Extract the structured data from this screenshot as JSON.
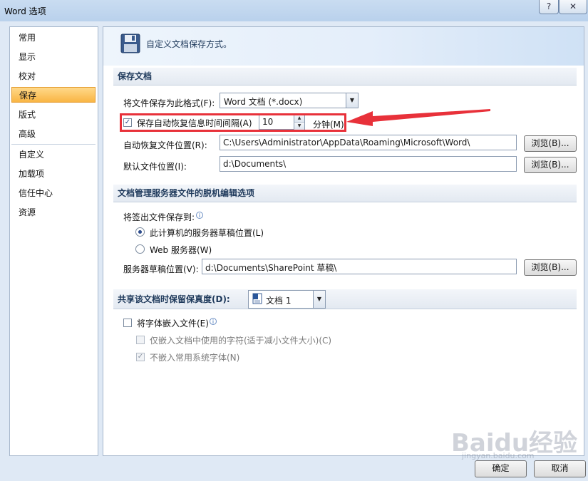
{
  "window": {
    "title": "Word 选项",
    "help_label": "?",
    "close_label": "✕"
  },
  "sidebar": {
    "items": [
      {
        "label": "常用"
      },
      {
        "label": "显示"
      },
      {
        "label": "校对"
      },
      {
        "label": "保存",
        "selected": true
      },
      {
        "label": "版式"
      },
      {
        "label": "高级"
      },
      {
        "label": "自定义"
      },
      {
        "label": "加载项"
      },
      {
        "label": "信任中心"
      },
      {
        "label": "资源"
      }
    ]
  },
  "banner": {
    "text": "自定义文档保存方式。"
  },
  "save_section": {
    "heading": "保存文档",
    "format_label": "将文件保存为此格式(F):",
    "format_value": "Word 文档 (*.docx)",
    "autorecover_label": "保存自动恢复信息时间间隔(A)",
    "autorecover_checked": true,
    "autorecover_minutes": "10",
    "minutes_label": "分钟(M)",
    "autorecover_path_label": "自动恢复文件位置(R):",
    "autorecover_path": "C:\\Users\\Administrator\\AppData\\Roaming\\Microsoft\\Word\\",
    "default_path_label": "默认文件位置(I):",
    "default_path": "d:\\Documents\\",
    "browse_label": "浏览(B)..."
  },
  "offline_section": {
    "heading": "文档管理服务器文件的脱机编辑选项",
    "checkout_label": "将签出文件保存到:",
    "option_local": "此计算机的服务器草稿位置(L)",
    "option_web": "Web 服务器(W)",
    "selected_option": "local",
    "drafts_label": "服务器草稿位置(V):",
    "drafts_path": "d:\\Documents\\SharePoint 草稿\\",
    "browse_label": "浏览(B)..."
  },
  "fidelity_section": {
    "heading": "共享该文档时保留保真度(D):",
    "document_value": "文档 1",
    "embed_fonts_label": "将字体嵌入文件(E)",
    "embed_fonts_checked": false,
    "embed_used_chars_label": "仅嵌入文档中使用的字符(适于减小文件大小)(C)",
    "embed_used_chars_checked": false,
    "no_common_fonts_label": "不嵌入常用系统字体(N)",
    "no_common_fonts_checked": true
  },
  "footer": {
    "ok_label": "确定",
    "cancel_label": "取消"
  },
  "watermark": {
    "text": "Baidu经验",
    "sub": "jingyan.baidu.com"
  },
  "colors": {
    "highlight": "#e8313a",
    "selected_nav": "#f9b544",
    "accent": "#1e395b"
  }
}
